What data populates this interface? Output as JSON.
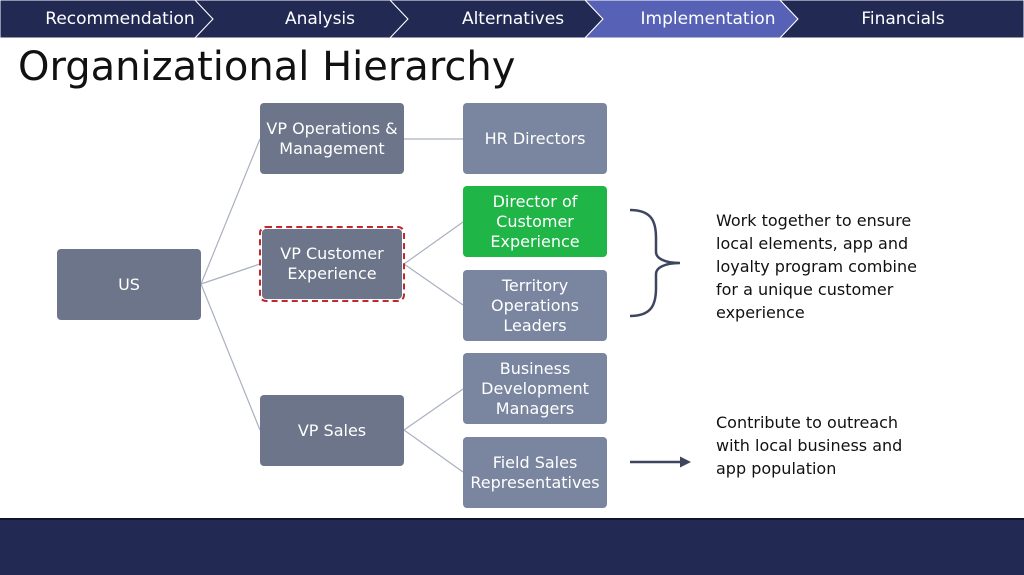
{
  "nav": {
    "tabs": [
      {
        "label": "Recommendation",
        "active": false
      },
      {
        "label": "Analysis",
        "active": false
      },
      {
        "label": "Alternatives",
        "active": false
      },
      {
        "label": "Implementation",
        "active": true
      },
      {
        "label": "Financials",
        "active": false
      }
    ],
    "colors": {
      "tab": "#222a54",
      "active_tab": "#5762b6"
    }
  },
  "page_title": "Organizational Hierarchy",
  "org": {
    "root": "US",
    "vp_operations": "VP Operations & Management",
    "hr_directors": "HR Directors",
    "vp_customer_experience": "VP Customer Experience",
    "director_customer_experience": "Director of Customer Experience",
    "territory_operations_leaders": "Territory Operations Leaders",
    "vp_sales": "VP Sales",
    "business_development_managers": "Business Development Managers",
    "field_sales_representatives": "Field Sales Representatives"
  },
  "notes": {
    "customer_experience": "Work together to ensure local elements, app and loyalty program combine for a unique customer experience",
    "sales": "Contribute to outreach with local business and app population"
  },
  "colors": {
    "node": "#7a859f",
    "highlight_node": "#1fb547",
    "dashed_outline": "#c0282d",
    "footer": "#222a54"
  },
  "icons": {
    "bracket": "right-curly-brace-icon",
    "arrow": "arrow-right-icon"
  }
}
